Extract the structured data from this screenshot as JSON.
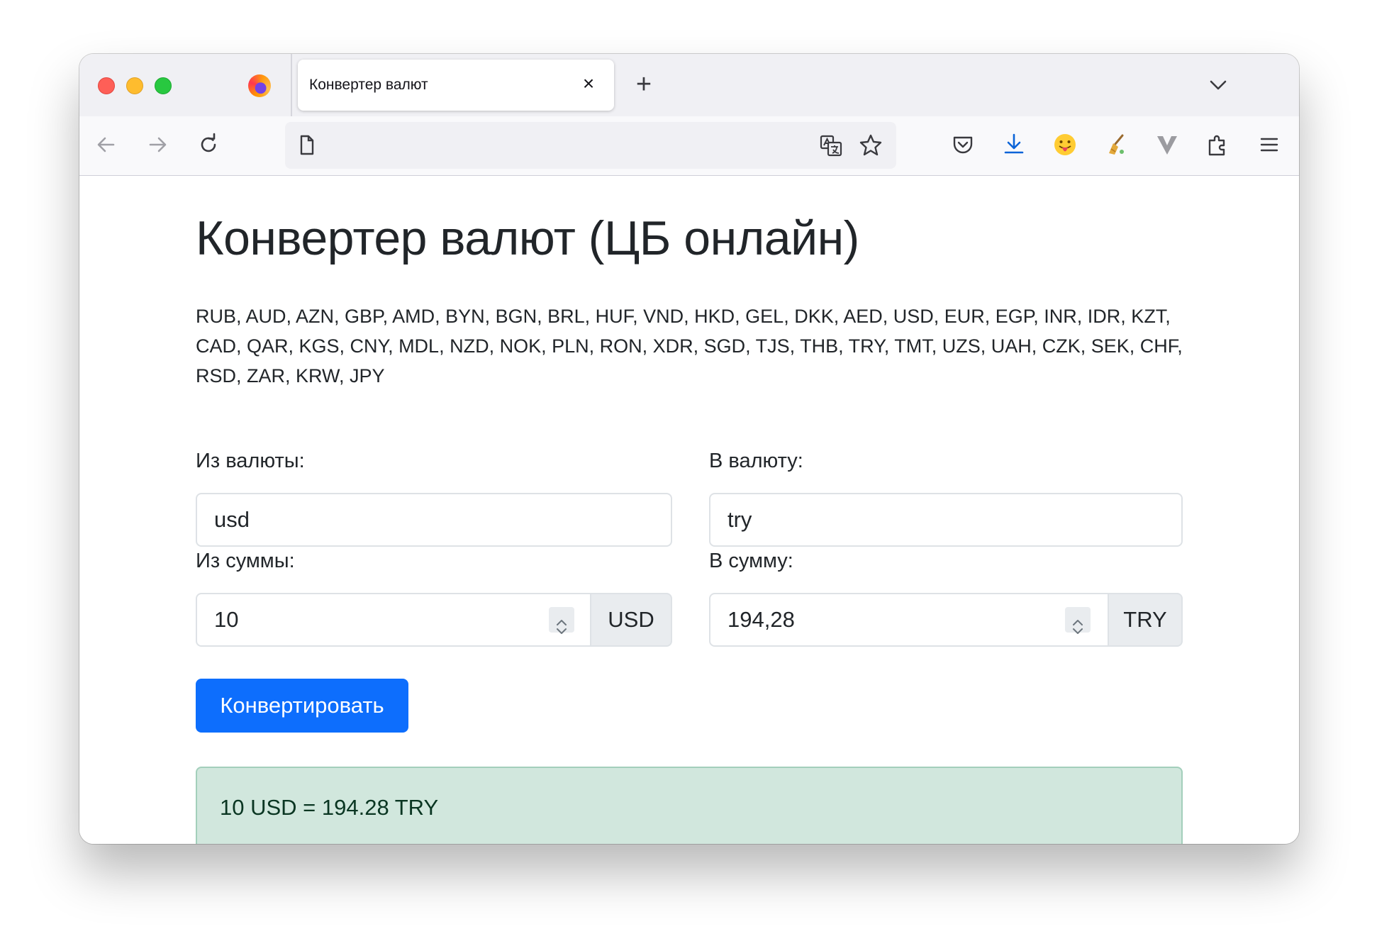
{
  "browser": {
    "tab_title": "Конвертер валют",
    "tab_close_icon": "×",
    "new_tab_icon": "+"
  },
  "page": {
    "heading": "Конвертер валют (ЦБ онлайн)",
    "currency_codes": "RUB, AUD, AZN, GBP, AMD, BYN, BGN, BRL, HUF, VND, HKD, GEL, DKK, AED, USD, EUR, EGP, INR, IDR, KZT, CAD, QAR, KGS, CNY, MDL, NZD, NOK, PLN, RON, XDR, SGD, TJS, THB, TRY, TMT, UZS, UAH, CZK, SEK, CHF, RSD, ZAR, KRW, JPY",
    "from_currency_label": "Из валюты:",
    "from_currency_value": "usd",
    "to_currency_label": "В валюту:",
    "to_currency_value": "try",
    "from_amount_label": "Из суммы:",
    "from_amount_value": "10",
    "from_amount_suffix": "USD",
    "to_amount_label": "В сумму:",
    "to_amount_value": "194,28",
    "to_amount_suffix": "TRY",
    "convert_button": "Конвертировать",
    "result": "10 USD = 194.28 TRY"
  },
  "colors": {
    "primary": "#0d6efd",
    "alert_bg": "#d1e7dd",
    "alert_text": "#0a3622"
  }
}
